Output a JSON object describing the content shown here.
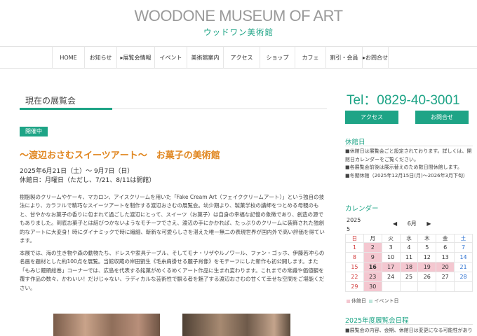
{
  "header": {
    "logo_en": "WOODONE MUSEUM OF ART",
    "logo_jp": "ウッドワン美術館"
  },
  "nav": [
    {
      "label": "HOME",
      "w": 46
    },
    {
      "label": "お知らせ",
      "w": 46
    },
    {
      "label": "▸展覧会情報",
      "w": 54
    },
    {
      "label": "イベント",
      "w": 46
    },
    {
      "label": "美術館案内",
      "w": 52
    },
    {
      "label": "アクセス",
      "w": 52
    },
    {
      "label": "ショップ",
      "w": 50
    },
    {
      "label": "カフェ",
      "w": 44
    },
    {
      "label": "割引・会員",
      "w": 52
    },
    {
      "label": "▸お問合せ",
      "w": 38
    }
  ],
  "main": {
    "section_title": "現在の展覧会",
    "badge": "開催中",
    "exhibition_title": "〜渡辺おさむスイーツアート〜　お菓子の美術館",
    "period": "2025年6月21日（土）〜 9月7日（日）",
    "closed_days": "休館日：月曜日（ただし、7/21、8/11は開館）",
    "paragraph1": "樹脂製のクリームやケーキ、マカロン、アイスクリームを用いた「Fake Cream Art（フェイククリームアート）」という独自の技法により、カラフルで精巧なスイーツアートを制作する渡辺おさむの展覧会。幼少期より、製菓学校の講師をつとめる母親のもと、甘やかなお菓子の香りに包まれて過ごした渡辺にとって、スイーツ（お菓子）は自身の幸福な記憶の象徴であり、創造の源でもありました。到底お菓子とは結びつかないようなモチーフでさえ、渡辺の手にかかれば、たっぷりのクリームに装飾された独創的なアートに大変身！時にダイナミックで時に繊細、斬新な可愛らしさを湛えた唯一無二の表現世界が国内外で高い評価を得ています。",
    "paragraph2": "本展では、海の生き物や森の動物たち、ドレスや家具テーブル、そしてモナ・リザやルノワール、ファン・ゴッホ、伊藤若冲らの名画を題材とした約100点を展覧。当館収蔵の岸田劉生《毛糸肩掛せる麗子肖像》をモチーフにした新作も初公開します。また「もみじ饅頭総巻」コーナーでは、広島を代表する銘菓がめくるめくアート作品に生まれ変わります。これまでの常識や価値観を覆す作品の数々、かわいい！だけじゃない、ラディカルな芸術性で観る者を魅了する渡辺おさむの甘くて幸せな空間をご堪能ください。"
  },
  "sidebar": {
    "tel": "Tel：0829-40-3001",
    "access_button": "アクセス",
    "contact_button": "お問合せ",
    "closed_heading": "休館日",
    "closed_notes": [
      "■休館日は展覧会ごと設定されております。詳しくは、開館日カレンダーをご覧ください。",
      "■各展覧会前後は展示替えのため数日間休館します。",
      "■冬期休館（2025年12月15日(月)〜2026年3月下旬）"
    ],
    "calendar_heading": "カレンダー",
    "cal_year": "2025",
    "cal_month_num": "5",
    "cal_prev": "◀",
    "cal_month": "6月",
    "cal_next": "▶",
    "weekdays": [
      "日",
      "月",
      "火",
      "水",
      "木",
      "金",
      "土"
    ],
    "weeks": [
      [
        "1",
        "2",
        "3",
        "4",
        "5",
        "6",
        "7"
      ],
      [
        "8",
        "9",
        "10",
        "11",
        "12",
        "13",
        "14"
      ],
      [
        "15",
        "16",
        "17",
        "18",
        "19",
        "20",
        "21"
      ],
      [
        "22",
        "23",
        "24",
        "25",
        "26",
        "27",
        "28"
      ],
      [
        "29",
        "30",
        "",
        "",
        "",
        "",
        ""
      ]
    ],
    "closed_dates": [
      "2",
      "9",
      "16",
      "17",
      "18",
      "19",
      "20",
      "23",
      "30"
    ],
    "bold_dates": [
      "16"
    ],
    "legend_closed": "休館日",
    "legend_event": "イベント日",
    "schedule_heading": "2025年度展覧会日程",
    "schedule_note": "■展覧会の内容、会期、休館日は変更になる可能性があります。"
  },
  "colors": {
    "accent": "#1ea486",
    "title_orange": "#e0861f",
    "closed_pink": "#f4c7d0",
    "sunday": "#d23b3b",
    "saturday": "#2a6fd0"
  }
}
